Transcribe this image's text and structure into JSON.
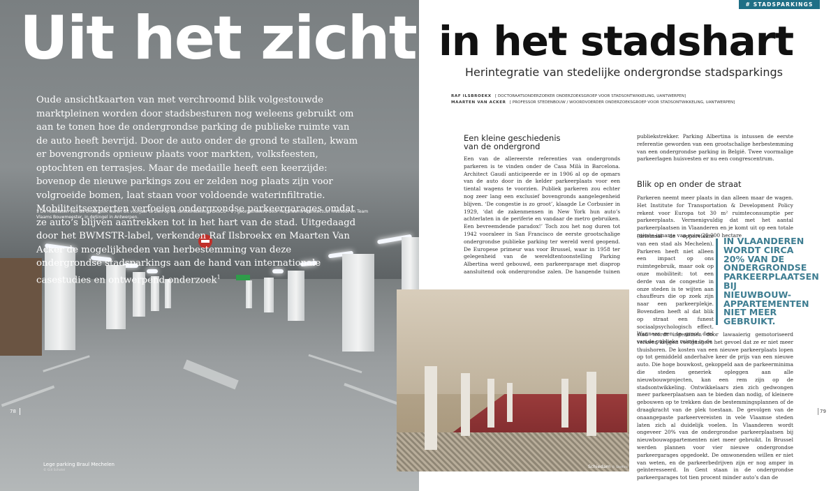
{
  "tag": "# STADSPARKINGS",
  "title_left": "Uit het zicht,",
  "title_right": "in het stadshart",
  "subtitle": "Herintegratie van stedelijke ondergrondse stadsparkings",
  "authors": [
    {
      "name": "RAF ILSBROEKX",
      "role": "[ DOCTORAATSONDERZOEKER ONDERZOEKSGROEP VOOR STADSONTWIKKELING, UANTWERPEN]"
    },
    {
      "name": "MAARTEN VAN ACKER",
      "role": "[ PROFESSOR STEDENBOUW / WOORDVOERDER ONDERZOEKSGROEP VOOR STADSONTWIKKELING, UANTWERPEN]"
    }
  ],
  "intro": "Oude ansichtkaarten van met verchroomd blik volgestouwde marktpleinen worden door stadsbesturen nog weleens gebruikt om aan te tonen hoe de ondergrondse parking de publieke ruimte van de auto heeft bevrijd. Door de auto onder de grond te stallen, kwam er bovengronds opnieuw plaats voor markten, volksfeesten, optochten en terrasjes. Maar de medaille heeft een keerzijde: bovenop de nieuwe parkings zou er zelden nog plaats zijn voor volgroeide bomen, laat staan voor voldoende waterinfiltratie. Mobiliteitsexperten verfoeien ondergrondse parkeergarages omdat ze auto’s blijven aantrekken tot in het hart van de stad. Uitgedaagd door het BWMSTR-label, verkenden Raf Ilsbroekx en Maarten Van Acker de mogelijkheden van herbestemming van deze ondergrondse stadsparkings aan de hand van internationale casestudies en ontwerpend onderzoek",
  "intro_sup": "1",
  "footnote": "1   De resultaten van dit onderzoek waren dit voorjaar te zien op de tentoonstelling ‘CASCO - 1’, georganiseerd door het Vlaams Architectuur Instituut en Team Vlaams Bouwmeester, in deSingel in Antwerpen.",
  "page_left": "78",
  "page_right": "79",
  "caption_left": "Lege parking Braul Mechelen",
  "caption_left_sub": "© Gill Schotel",
  "caption_right": "Schiedam",
  "caption_right_sub": "© Stoffels",
  "section1": {
    "heading": "Een kleine geschiedenis van de ondergrond",
    "text": "Een van de allereerste referenties van ondergronds parkeren is te vinden onder de Casa Milà in Barcelona. Architect Gaudí anticipeerde er in 1906 al op de opmars van de auto door in de kelder parkeerplaats voor een tiental wagens te voorzien. Publiek parkeren zou echter nog zeer lang een exclusief bovengronds aangelegenheid blijven. ‘De congestie is zo groot’, klaagde Le Corbusier in 1929, ‘dat de zakenmensen in New York hun auto’s achterlaten in de periferie en vandaar de metro gebruiken. Een bevreemdende paradox!’ Toch zou het nog duren tot 1942 vooraleer in San Francisco de eerste grootschalige ondergrondse publieke parking ter wereld werd geopend. De Europese primeur was voor Brussel, waar in 1958 ter gelegenheid van de wereldtentoonstelling Parking Albertina werd gebouwd, een parkeergarage met diaprop aansluitend ook ondergrondse zalen. De hangende tuinen van René Pechère bovenop de parking zijn vandaag nog altijd een",
    "text_cont": "publiekstrekker. Parking Albertina is intussen de eerste referentie geworden van een grootschalige herbestemming van een ondergrondse parking in België. Twee voormalige parkeerlagen huisvesten er nu een congrescentrum."
  },
  "section2": {
    "heading": "Blik op en onder de straat",
    "text_top": "Parkeren neemt meer plaats in dan alleen maar de wagen. Het Institute for Transportation & Development Policy rekent voor Europa tot 30 m² ruimteconsumptie per parkeerplaats. Vermenigvuldig dat met het aantal parkeerplaatsen in Vlaanderen en je komt uit op een totale ruimte-inname van ruim 20.000 hectare",
    "text_narrow": "(driemaal de oppervlakte van een stad als Mechelen). Parkeren heeft niet alleen een impact op ons ruimtegebruik, maar ook op onze mobiliteit: tot een derde van de congestie in onze steden is te wijten aan chauffeurs die op zoek zijn naar een parkeerplekje. Bovendien heeft al dat blik op straat een funest sociaalpsychologisch effect. Wanneer een te groot deel van de publieke ruimte in de",
    "text_bottom": "stad wordt ingenomen door lawaaierig gemotoriseerd verkeer, krijgen voetgangers het gevoel dat ze er niet meer thuishoren. De kosten van een nieuwe parkeerplaats lopen op tot gemiddeld anderhalve keer de prijs van een nieuwe auto. Die hoge bouwkost, gekoppeld aan de parkeerminima die steden generiek opleggen aan alle nieuwbouwprojecten, kan een rem zijn op de stadsontwikkeling. Ontwikkelaars zien zich gedwongen meer parkeerplaatsen aan te bieden dan nodig, of kleinere gebouwen op te trekken dan de bestemmingsplannen of de draagkracht van de plek toestaan. De gevolgen van de onaangepaste parkeervereisten in vele Vlaamse steden laten zich al duidelijk voelen. In Vlaanderen wordt ongeveer 20% van de ondergrondse parkeerplaatsen bij nieuwbouwappartementen niet meer gebruikt. In Brussel werden plannen voor vier nieuwe ondergrondse parkeergarages opgedoekt. De omwonenden willen er niet van weten, en de parkeerbedrijven zijn er nog amper in geïnteresseerd. In Gent staan in de ondergrondse parkeergarages tot tien procent minder auto’s dan de"
  },
  "pullquote": "IN VLAANDEREN WORDT CIRCA 20% VAN DE ONDERGRONDSE PARKEERPLAATSEN BIJ NIEUWBOUW-APPARTEMENTEN NIET MEER GEBRUIKT.",
  "colors": {
    "accent": "#3f7e92",
    "tag_bg": "#1f6f86"
  }
}
